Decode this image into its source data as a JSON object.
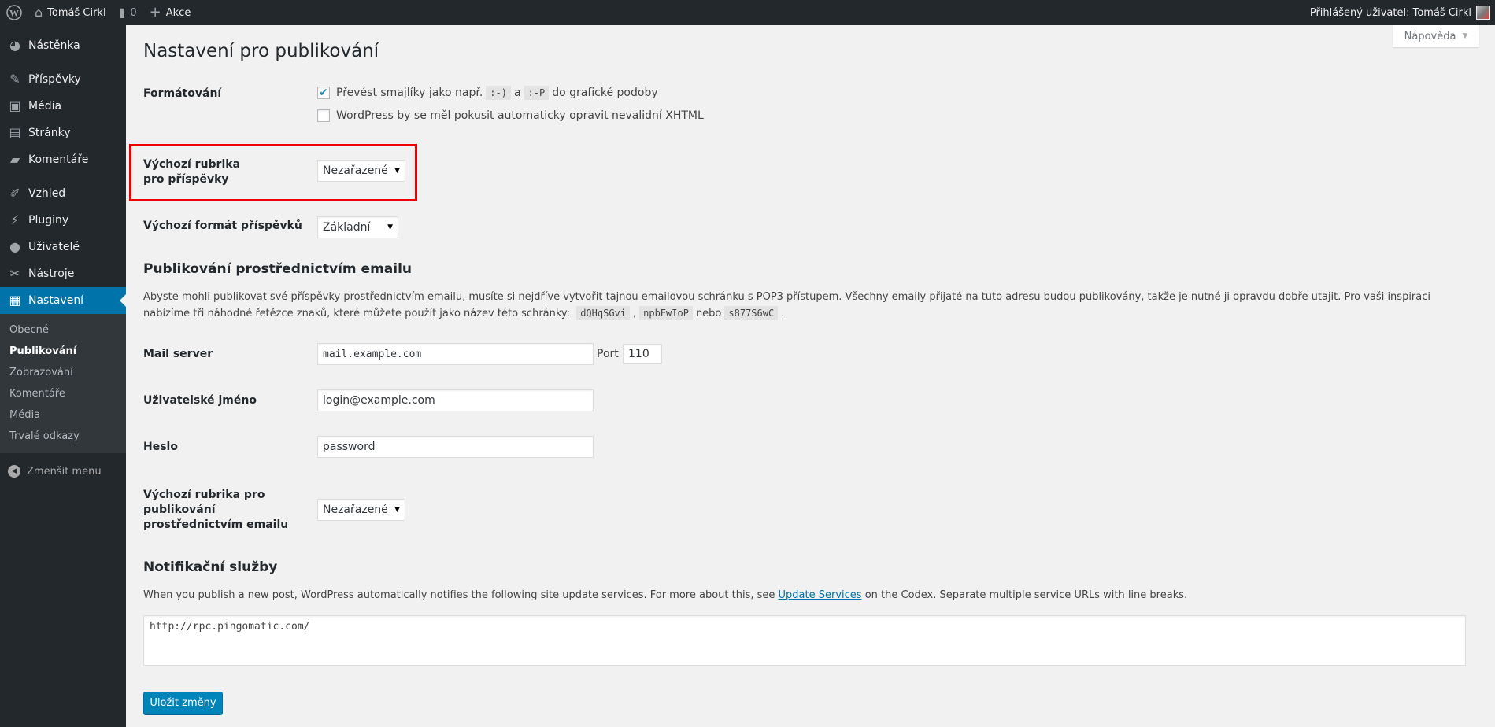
{
  "adminbar": {
    "site_name": "Tomáš Cirkl",
    "comments_count": "0",
    "new_label": "Akce",
    "user_greeting": "Přihlášený uživatel: Tomáš Cirkl"
  },
  "menu": {
    "items": [
      {
        "label": "Nástěnka",
        "icon": "dashboard-icon"
      },
      {
        "label": "Příspěvky",
        "icon": "pin-icon"
      },
      {
        "label": "Média",
        "icon": "media-icon"
      },
      {
        "label": "Stránky",
        "icon": "pages-icon"
      },
      {
        "label": "Komentáře",
        "icon": "comments-icon"
      },
      {
        "label": "Vzhled",
        "icon": "brush-icon"
      },
      {
        "label": "Pluginy",
        "icon": "plugin-icon"
      },
      {
        "label": "Uživatelé",
        "icon": "user-icon"
      },
      {
        "label": "Nástroje",
        "icon": "wrench-icon"
      },
      {
        "label": "Nastavení",
        "icon": "settings-icon"
      }
    ],
    "submenu": [
      "Obecné",
      "Publikování",
      "Zobrazování",
      "Komentáře",
      "Média",
      "Trvalé odkazy"
    ],
    "collapse_label": "Zmenšit menu"
  },
  "help_tab": "Nápověda",
  "page_title": "Nastavení pro publikování",
  "formatting": {
    "label": "Formátování",
    "opt1_before": "Převést smajlíky jako např.",
    "code1": ":-)",
    "opt1_and": "a",
    "code2": ":-P",
    "opt1_after": "do grafické podoby",
    "opt1_checked": true,
    "opt2": "WordPress by se měl pokusit automaticky opravit nevalidní XHTML",
    "opt2_checked": false
  },
  "default_category": {
    "label": "Výchozí rubrika pro příspěvky",
    "value": "Nezařazené"
  },
  "default_format": {
    "label": "Výchozí formát příspěvků",
    "value": "Základní"
  },
  "email_section": {
    "title": "Publikování prostřednictvím emailu",
    "desc_part1": "Abyste mohli publikovat své příspěvky prostřednictvím emailu, musíte si nejdříve vytvořit tajnou emailovou schránku s POP3 přístupem. Všechny emaily přijaté na tuto adresu budou publikovány, takže je nutné ji opravdu dobře utajit. Pro vaši inspiraci nabízíme tři náhodné řetězce znaků, které můžete použít jako název této schránky:",
    "code_a": "dQHqSGvi",
    "code_b": "npbEwIoP",
    "or_word": "nebo",
    "code_c": "s877S6wC",
    "mail_server_label": "Mail server",
    "mail_server_value": "mail.example.com",
    "port_label": "Port",
    "port_value": "110",
    "username_label": "Uživatelské jméno",
    "username_value": "login@example.com",
    "password_label": "Heslo",
    "password_value": "password",
    "mail_category_label": "Výchozí rubrika pro publikování prostřednictvím emailu",
    "mail_category_value": "Nezařazené"
  },
  "ping_section": {
    "title": "Notifikační služby",
    "desc_before": "When you publish a new post, WordPress automatically notifies the following site update services. For more about this, see",
    "link": "Update Services",
    "desc_after": "on the Codex. Separate multiple service URLs with line breaks.",
    "services": "http://rpc.pingomatic.com/"
  },
  "save_label": "Uložit změny",
  "colors": {
    "accent": "#0073aa",
    "button": "#0085ba",
    "highlight_box": "#e00000",
    "menu_bg": "#23282d"
  }
}
